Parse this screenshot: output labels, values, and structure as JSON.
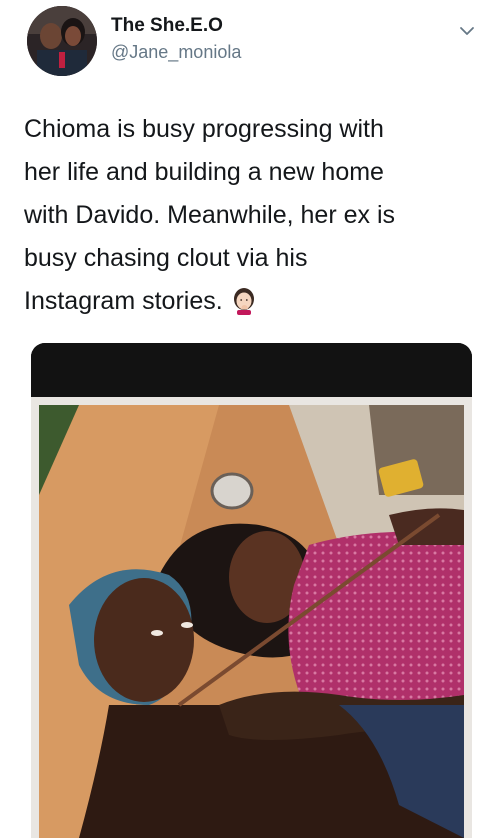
{
  "tweet": {
    "display_name": "The She.E.O",
    "handle": "@Jane_moniola",
    "text_lines": [
      "Chioma is busy progressing with",
      "her life and building  a new home",
      "with Davido. Meanwhile, her ex is",
      "busy chasing clout via his",
      "Instagram stories."
    ],
    "emoji": "face-with-hand-over-mouth-emoji"
  },
  "icons": {
    "menu": "chevron-down-icon"
  },
  "colors": {
    "text": "#14171a",
    "secondary": "#657786",
    "media_bar": "#121212"
  }
}
